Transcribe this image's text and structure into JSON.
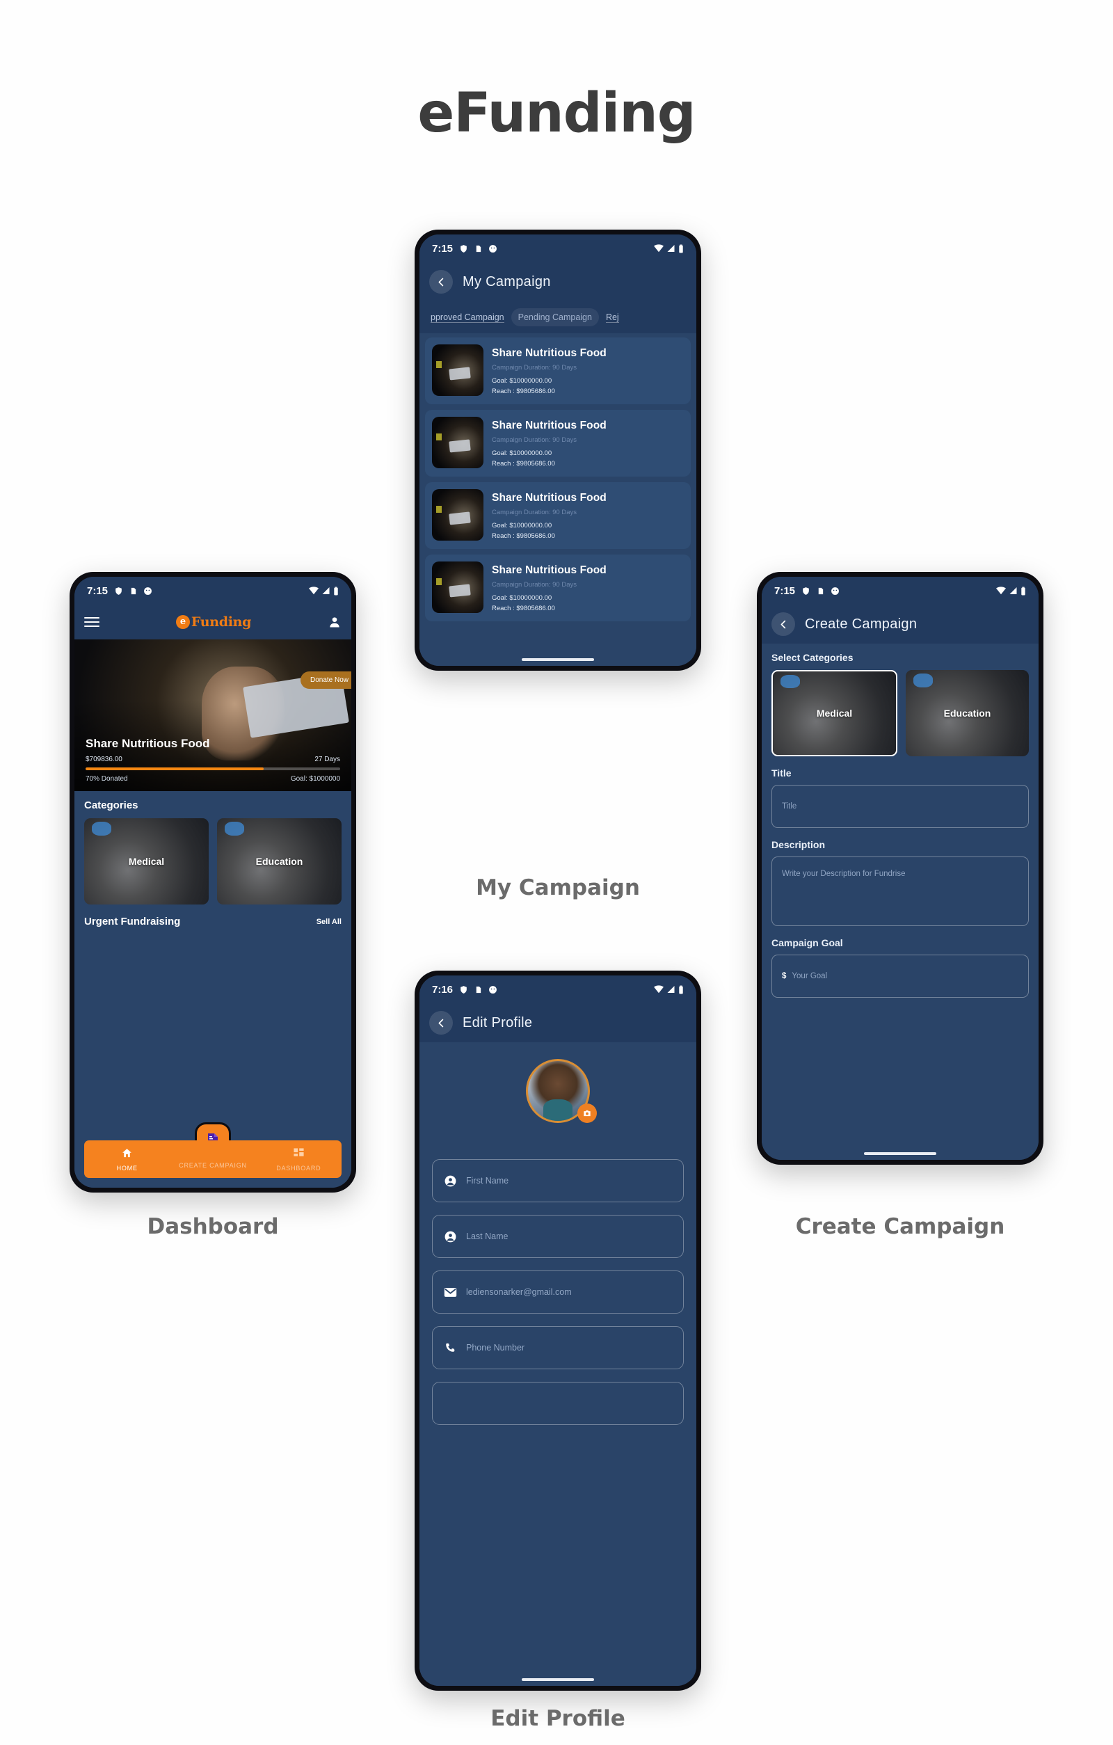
{
  "app": {
    "title": "eFunding",
    "brand_color": "#f5821f",
    "navy": "#223a5e",
    "screen_bg": "#2a4468"
  },
  "screens": {
    "dashboard": {
      "caption": "Dashboard",
      "status": {
        "time": "7:15",
        "icons": [
          "shield-icon",
          "sd-card-icon",
          "face-icon"
        ],
        "right_icons": [
          "wifi-icon",
          "signal-icon",
          "battery-icon"
        ]
      },
      "brand": "Funding",
      "brand_mark": "e",
      "hero": {
        "title": "Share Nutritious Food",
        "raised": "$709836.00",
        "days_left": "27 Days",
        "donated_pct_label": "70% Donated",
        "progress_percent": 70,
        "goal": "Goal: $1000000",
        "donate_button": "Donate Now"
      },
      "categories_title": "Categories",
      "categories": [
        {
          "label": "Medical"
        },
        {
          "label": "Education"
        }
      ],
      "urgent_title": "Urgent Fundraising",
      "sell_all": "Sell All",
      "bottom_nav": [
        {
          "label": "HOME",
          "icon": "home-icon",
          "active": true
        },
        {
          "label": "CREATE CAMPAIGN",
          "icon": "plus-icon",
          "active": false
        },
        {
          "label": "DASHBOARD",
          "icon": "grid-icon",
          "active": false
        }
      ],
      "fab_icon": "invoice-dollar-icon"
    },
    "my_campaign": {
      "caption": "My Campaign",
      "status": {
        "time": "7:15"
      },
      "title": "My Campaign",
      "tabs": [
        {
          "label": "pproved Campaign",
          "active": false
        },
        {
          "label": "Pending Campaign",
          "active": true
        },
        {
          "label": "Rej",
          "active": false
        }
      ],
      "cards": [
        {
          "title": "Share Nutritious Food",
          "duration": "Campaign Duration: 90  Days",
          "goal": "Goal: $10000000.00",
          "reach": "Reach : $9805686.00"
        },
        {
          "title": "Share Nutritious Food",
          "duration": "Campaign Duration: 90  Days",
          "goal": "Goal: $10000000.00",
          "reach": "Reach : $9805686.00"
        },
        {
          "title": "Share Nutritious Food",
          "duration": "Campaign Duration: 90  Days",
          "goal": "Goal: $10000000.00",
          "reach": "Reach : $9805686.00"
        },
        {
          "title": "Share Nutritious Food",
          "duration": "Campaign Duration: 90  Days",
          "goal": "Goal: $10000000.00",
          "reach": "Reach : $9805686.00"
        }
      ]
    },
    "create_campaign": {
      "caption": "Create Campaign",
      "status": {
        "time": "7:15"
      },
      "title": "Create Campaign",
      "select_categories_label": "Select Categories",
      "categories": [
        {
          "label": "Medical",
          "selected": true
        },
        {
          "label": "Education",
          "selected": false
        }
      ],
      "title_label": "Title",
      "title_placeholder": "Title",
      "description_label": "Description",
      "description_placeholder": "Write your Description for Fundrise",
      "goal_label": "Campaign Goal",
      "goal_currency": "$",
      "goal_placeholder": "Your Goal"
    },
    "edit_profile": {
      "caption": "Edit Profile",
      "status": {
        "time": "7:16"
      },
      "title": "Edit Profile",
      "avatar_badge_icon": "camera-icon",
      "fields": [
        {
          "icon": "person-icon",
          "value": "First Name"
        },
        {
          "icon": "person-icon",
          "value": "Last Name"
        },
        {
          "icon": "envelope-icon",
          "value": "lediensonarker@gmail.com"
        },
        {
          "icon": "phone-icon",
          "value": "Phone Number"
        },
        {
          "icon": "",
          "value": ""
        }
      ]
    }
  }
}
